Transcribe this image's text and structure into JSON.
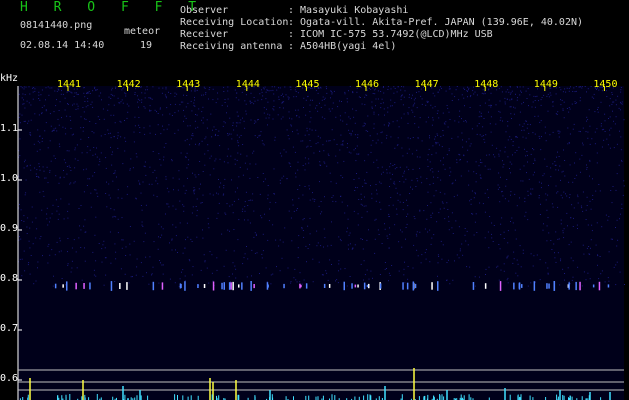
{
  "header": {
    "app_title": "H R O F F T",
    "filename": "08141440.png",
    "datetime": "02.08.14 14:40",
    "meteor_label": "meteor",
    "meteor_count": "19",
    "observer_label": "Observer",
    "observer_value": ": Masayuki Kobayashi",
    "location_label": "Receiving Location",
    "location_value": ": Ogata-vill. Akita-Pref. JAPAN (139.96E, 40.02N)",
    "receiver_label": "Receiver",
    "receiver_value": ": ICOM IC-575 53.7492(@LCD)MHz USB",
    "antenna_label": "Receiving antenna",
    "antenna_value": ": A504HB(yagi 4el)"
  },
  "plot": {
    "y_unit": "kHz",
    "y_ticks": [
      "1.1",
      "1.0",
      "0.9",
      "0.8",
      "0.7",
      "0.6"
    ],
    "x_ticks": [
      "1441",
      "1442",
      "1443",
      "1444",
      "1445",
      "1446",
      "1447",
      "1448",
      "1449",
      "1450"
    ],
    "colors": {
      "background": "#00001a",
      "noise": "#1a1a7a",
      "signal": "#5080ff",
      "echo": "#ffff40",
      "axis": "#ffffff",
      "tick_label": "#ffff00",
      "trace": "#40e0ff"
    }
  }
}
